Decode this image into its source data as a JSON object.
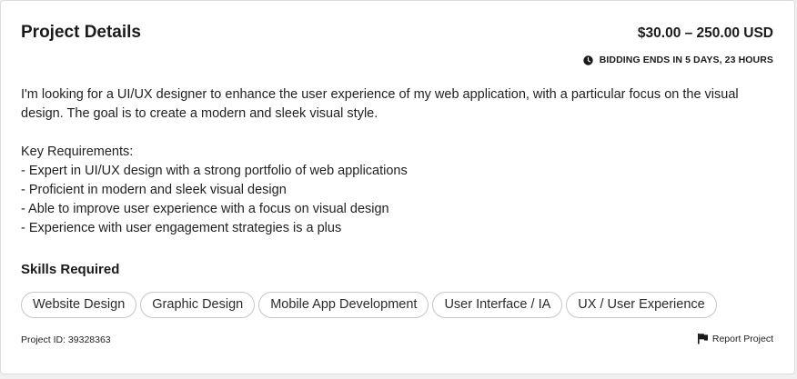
{
  "project": {
    "title": "Project Details",
    "budget": "$30.00 – 250.00 USD",
    "bidding": "BIDDING ENDS IN 5 DAYS, 23 HOURS",
    "description": [
      "I'm looking for a UI/UX designer to enhance the user experience of my web application, with a particular focus on the visual design. The goal is to create a modern and sleek visual style.",
      "",
      "Key Requirements:",
      "- Expert in UI/UX design with a strong portfolio of web applications",
      "- Proficient in modern and sleek visual design",
      "- Able to improve user experience with a focus on visual design",
      "- Experience with user engagement strategies is a plus"
    ],
    "skills_title": "Skills Required",
    "skills": [
      "Website Design",
      "Graphic Design",
      "Mobile App Development",
      "User Interface / IA",
      "UX / User Experience"
    ],
    "project_id": "Project ID: 39328363",
    "report_label": "Report Project"
  },
  "icons": {
    "clock": "clock-icon",
    "flag": "flag-icon"
  },
  "colors": {
    "text": "#1a1a1a",
    "tag_border": "#c6c6c6",
    "card_bg": "#ffffff"
  }
}
